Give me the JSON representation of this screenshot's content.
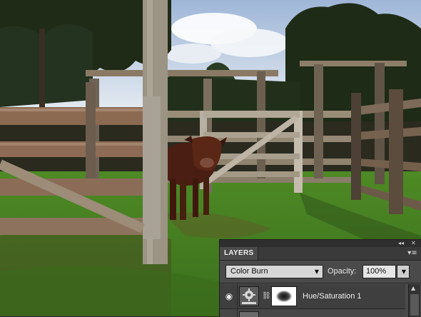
{
  "panel": {
    "collapse_icon": "double-chevron-icon",
    "close_icon": "close-icon",
    "tab_label": "LAYERS",
    "menu_icon": "panel-menu-icon",
    "blend_mode": "Color Burn",
    "opacity_label": "Opacity:",
    "opacity_value": "100%",
    "layers": [
      {
        "name": "Hue/Saturation 1",
        "visible": true,
        "type": "adjustment"
      }
    ]
  },
  "glyphs": {
    "collapse": "◂◂",
    "close": "✕",
    "menu": "▾≡",
    "caret": "▼",
    "eye": "◉",
    "chain": "⛓",
    "scroll_up": "▲"
  }
}
